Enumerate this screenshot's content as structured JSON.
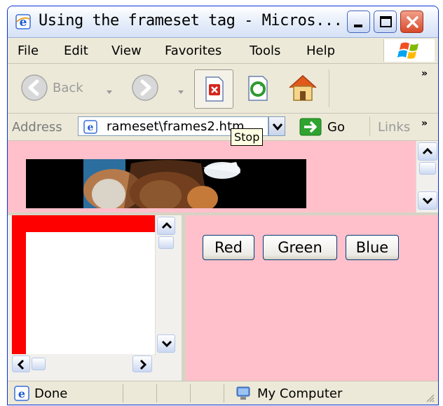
{
  "window": {
    "title": "Using the frameset tag - Micros..."
  },
  "menu": {
    "items": [
      {
        "label": "File"
      },
      {
        "label": "Edit"
      },
      {
        "label": "View"
      },
      {
        "label": "Favorites"
      },
      {
        "label": "Tools"
      },
      {
        "label": "Help"
      }
    ]
  },
  "toolbar": {
    "back_label": "Back",
    "chevron": "»"
  },
  "address": {
    "label": "Address",
    "value": "rameset\\frames2.htm",
    "go_label": "Go",
    "links_label": "Links",
    "chevron": "»"
  },
  "tooltip": {
    "text": "Stop"
  },
  "frames": {
    "buttons": [
      {
        "label": "Red"
      },
      {
        "label": "Green"
      },
      {
        "label": "Blue"
      }
    ]
  },
  "status": {
    "text": "Done",
    "zone": "My Computer"
  },
  "colors": {
    "pink": "#ffc0cb",
    "red": "#ff0000",
    "xp_blue": "#0831d9"
  }
}
